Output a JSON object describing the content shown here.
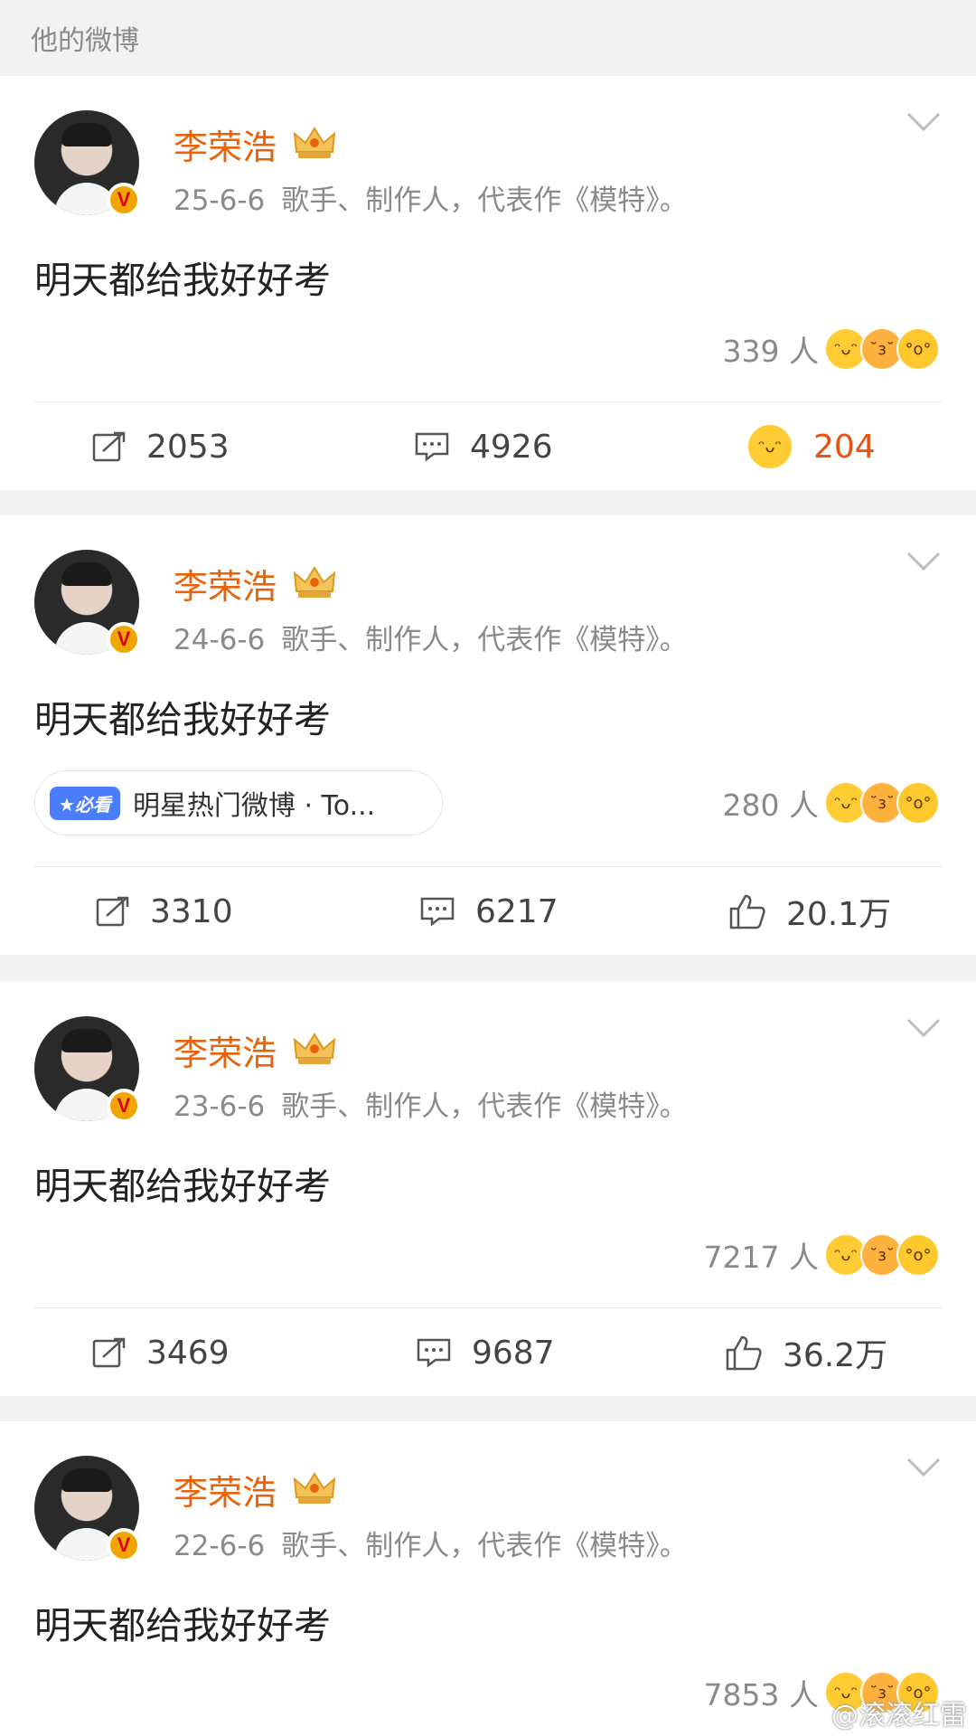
{
  "header": {
    "title": "他的微博"
  },
  "posts": [
    {
      "author": "李荣浩",
      "date": "25-6-6",
      "bio": "歌手、制作人，代表作《模特》。",
      "text": "明天都给我好好考",
      "reaction_count": "339 人",
      "repost": "2053",
      "comment": "4926",
      "like": "204",
      "like_style": "emoji-laugh",
      "pill": null
    },
    {
      "author": "李荣浩",
      "date": "24-6-6",
      "bio": "歌手、制作人，代表作《模特》。",
      "text": "明天都给我好好考",
      "reaction_count": "280 人",
      "repost": "3310",
      "comment": "6217",
      "like": "20.1万",
      "like_style": "thumb",
      "pill": {
        "tag": "★必看",
        "text": "明星热门微博 · To..."
      }
    },
    {
      "author": "李荣浩",
      "date": "23-6-6",
      "bio": "歌手、制作人，代表作《模特》。",
      "text": "明天都给我好好考",
      "reaction_count": "7217 人",
      "repost": "3469",
      "comment": "9687",
      "like": "36.2万",
      "like_style": "thumb",
      "pill": null
    },
    {
      "author": "李荣浩",
      "date": "22-6-6",
      "bio": "歌手、制作人，代表作《模特》。",
      "text": "明天都给我好好考",
      "reaction_count": "7853 人",
      "pill": null
    }
  ],
  "watermark": "@滚滚红雷",
  "colors": {
    "accent": "#e8620a",
    "like_active": "#e8520e",
    "badge": "#f0a500",
    "pill_tag": "#4a7dff"
  },
  "icons": [
    "avatar",
    "verified-badge-icon",
    "crown-icon",
    "chevron-down-icon",
    "repost-icon",
    "comment-icon",
    "like-icon",
    "laugh-emoji-icon",
    "kiss-emoji-icon",
    "wow-emoji-icon"
  ]
}
